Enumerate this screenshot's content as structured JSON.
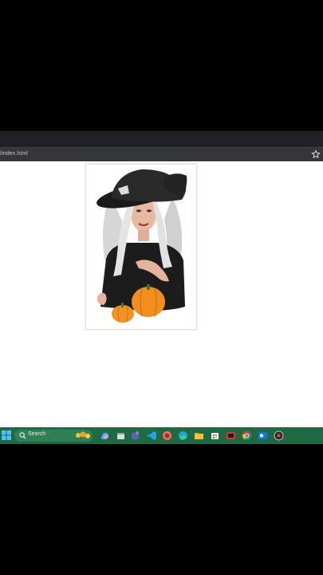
{
  "browser": {
    "url": "/index.html",
    "icons": {
      "bookmark": "star-icon"
    }
  },
  "page": {
    "image": {
      "subject": "witch-portrait",
      "colors": {
        "hat": "#222222",
        "hair": "#d9d9d9",
        "pumpkin": "#f29421",
        "border": "#f1d7cc"
      }
    }
  },
  "taskbar": {
    "background": "#1f6a45",
    "search_label": "Search",
    "icons": [
      "start-icon",
      "search-icon",
      "copilot-icon",
      "teams-icon",
      "file-explorer-icon",
      "vscode-icon",
      "firefox-icon",
      "edge-icon",
      "folder-icon",
      "store-icon",
      "app-icon",
      "chrome-icon",
      "outlook-icon",
      "obs-icon"
    ]
  }
}
